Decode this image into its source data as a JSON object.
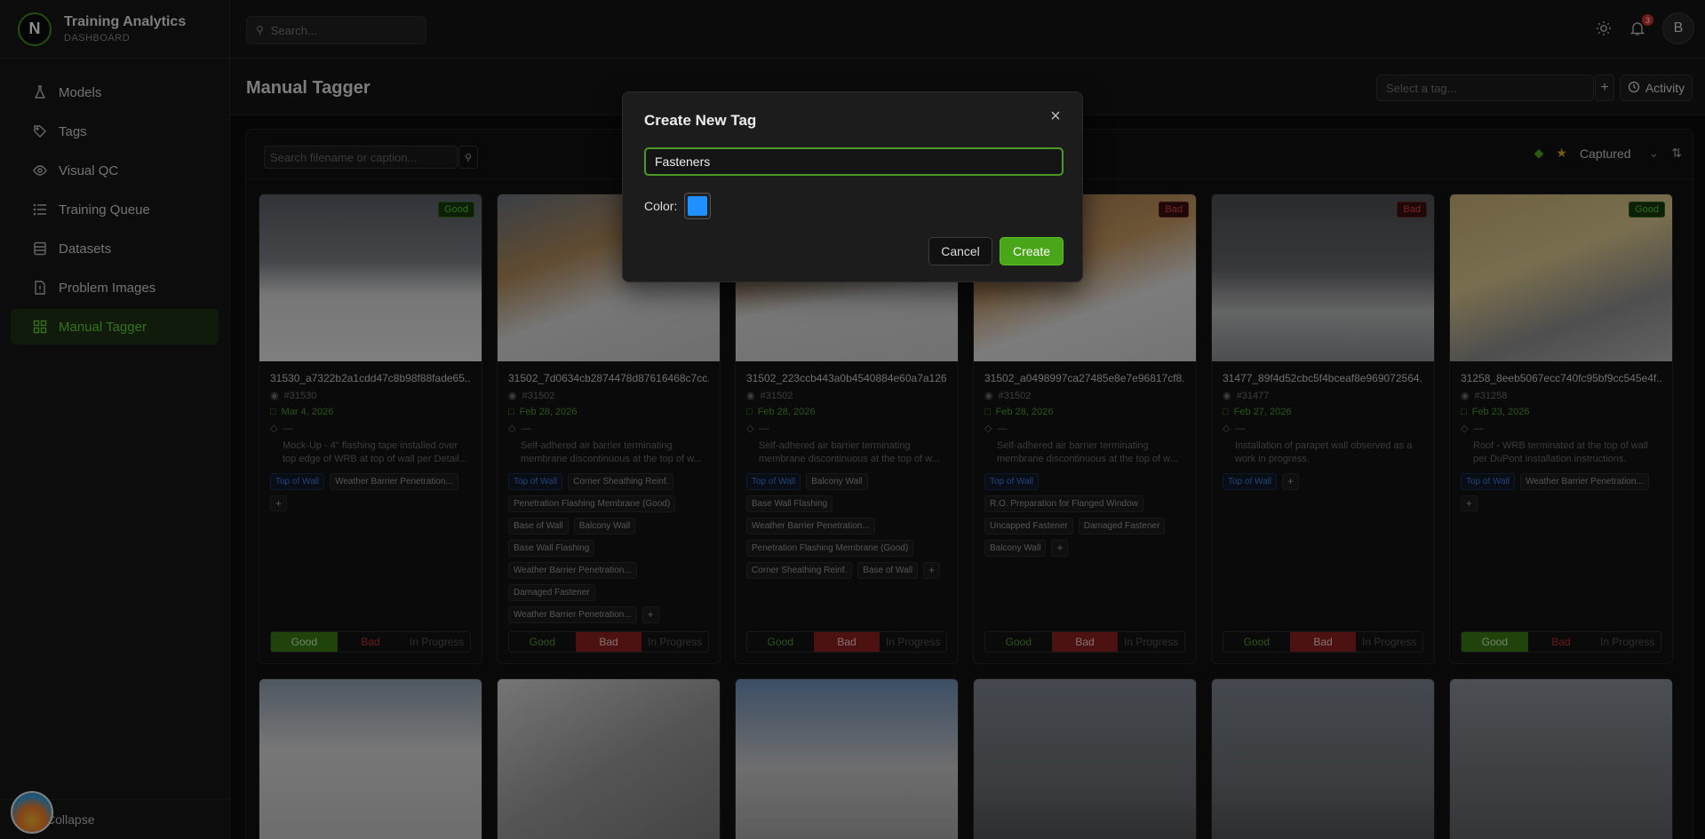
{
  "brand": {
    "logo_letter": "N",
    "title": "Training Analytics",
    "subtitle": "DASHBOARD"
  },
  "sidebar": {
    "items": [
      {
        "label": "Models",
        "icon": "flask-icon"
      },
      {
        "label": "Tags",
        "icon": "tag-icon"
      },
      {
        "label": "Visual QC",
        "icon": "eye-icon"
      },
      {
        "label": "Training Queue",
        "icon": "list-icon"
      },
      {
        "label": "Datasets",
        "icon": "database-icon"
      },
      {
        "label": "Problem Images",
        "icon": "file-alert-icon"
      },
      {
        "label": "Manual Tagger",
        "icon": "grid-icon",
        "active": true
      }
    ],
    "collapse_label": "Collapse"
  },
  "topbar": {
    "search_placeholder": "Search...",
    "notification_count": "3",
    "avatar_letter": "B"
  },
  "page": {
    "title": "Manual Tagger",
    "tag_select_placeholder": "Select a tag...",
    "activity_label": "Activity"
  },
  "filter": {
    "search_placeholder": "Search filename or caption...",
    "sort_label": "Captured"
  },
  "cards": [
    {
      "filename": "31530_a7322b2a1cdd47c8b98f88fade65...",
      "job": "#31530",
      "date": "Mar 4, 2026",
      "tags_line": "—",
      "caption": "Mock-Up - 4\" flashing tape installed over top edge of WRB at top of wall per Detail...",
      "status": "Good",
      "decision": "good",
      "chips": [
        {
          "text": "Top of Wall",
          "blue": true
        },
        {
          "text": "Weather Barrier Penetration..."
        }
      ]
    },
    {
      "filename": "31502_7d0634cb2874478d87616468c7cc...",
      "job": "#31502",
      "date": "Feb 28, 2026",
      "tags_line": "—",
      "caption": "Self-adhered air barrier terminating membrane discontinuous at the top of w...",
      "status": "",
      "decision": "bad",
      "chips": [
        {
          "text": "Top of Wall",
          "blue": true
        },
        {
          "text": "Corner Sheathing Reinf."
        },
        {
          "text": "Penetration Flashing Membrane (Good)"
        },
        {
          "text": "Base of Wall"
        },
        {
          "text": "Balcony Wall"
        },
        {
          "text": "Base Wall Flashing"
        },
        {
          "text": "Weather Barrier Penetration..."
        },
        {
          "text": "Damaged Fastener"
        },
        {
          "text": "Weather Barrier Penetration..."
        }
      ]
    },
    {
      "filename": "31502_223ccb443a0b4540884e60a7a126...",
      "job": "#31502",
      "date": "Feb 28, 2026",
      "tags_line": "—",
      "caption": "Self-adhered air barrier terminating membrane discontinuous at the top of w...",
      "status": "",
      "decision": "bad",
      "chips": [
        {
          "text": "Top of Wall",
          "blue": true
        },
        {
          "text": "Balcony Wall"
        },
        {
          "text": "Base Wall Flashing"
        },
        {
          "text": "Weather Barrier Penetration..."
        },
        {
          "text": "Penetration Flashing Membrane (Good)"
        },
        {
          "text": "Corner Sheathing Reinf."
        },
        {
          "text": "Base of Wall"
        }
      ]
    },
    {
      "filename": "31502_a0498997ca27485e8e7e96817cf8...",
      "job": "#31502",
      "date": "Feb 28, 2026",
      "tags_line": "—",
      "caption": "Self-adhered air barrier terminating membrane discontinuous at the top of w...",
      "status": "Bad",
      "decision": "bad",
      "chips": [
        {
          "text": "Top of Wall",
          "blue": true
        },
        {
          "text": "R.O. Preparation for Flanged Window"
        },
        {
          "text": "Uncapped Fastener"
        },
        {
          "text": "Damaged Fastener"
        },
        {
          "text": "Balcony Wall"
        }
      ]
    },
    {
      "filename": "31477_89f4d52cbc5f4bceaf8e969072564...",
      "job": "#31477",
      "date": "Feb 27, 2026",
      "tags_line": "—",
      "caption": "Installation of parapet wall observed as a work in progress.",
      "status": "Bad",
      "decision": "bad",
      "chips": [
        {
          "text": "Top of Wall",
          "blue": true
        }
      ]
    },
    {
      "filename": "31258_8eeb5067ecc740fc95bf9cc545e4f...",
      "job": "#31258",
      "date": "Feb 23, 2026",
      "tags_line": "—",
      "caption": "Roof - WRB terminated at the top of wall per DuPont installation instructions.",
      "status": "Good",
      "decision": "good",
      "chips": [
        {
          "text": "Top of Wall",
          "blue": true
        },
        {
          "text": "Weather Barrier Penetration..."
        }
      ]
    }
  ],
  "segment_labels": {
    "good": "Good",
    "bad": "Bad",
    "progress": "In Progress"
  },
  "modal": {
    "title": "Create New Tag",
    "input_value": "Fasteners",
    "color_label": "Color:",
    "color_value": "#1e90ff",
    "cancel_label": "Cancel",
    "create_label": "Create"
  },
  "colors": {
    "accent": "#4aa619",
    "good": "#3a7a14",
    "bad": "#8a1f1f",
    "tag_blue": "#3d7ad8"
  }
}
